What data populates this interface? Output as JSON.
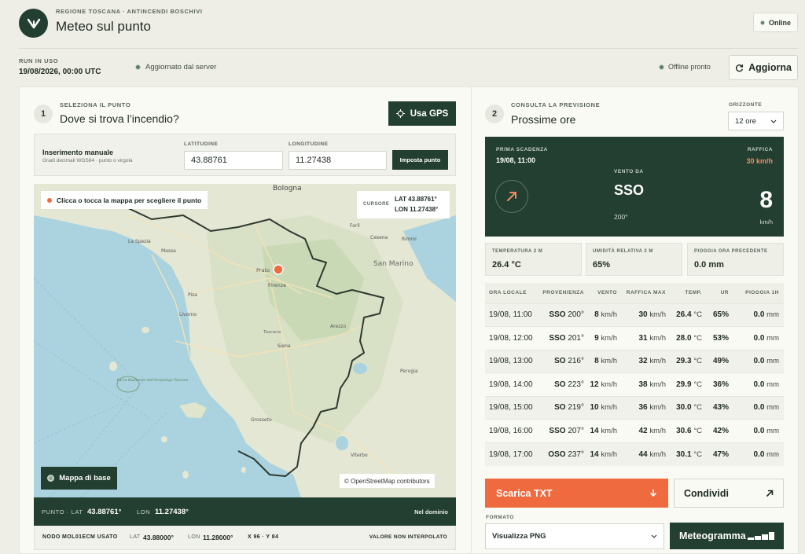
{
  "header": {
    "org": "REGIONE TOSCANA · ANTINCENDI BOSCHIVI",
    "title": "Meteo sul punto",
    "status": "Online"
  },
  "run": {
    "label": "RUN IN USO",
    "value": "19/08/2026, 00:00 UTC",
    "server_status": "Aggiornato dal server",
    "offline_status": "Offline pronto",
    "refresh_label": "Aggiorna"
  },
  "left": {
    "step": "1",
    "kicker": "SELEZIONA IL PUNTO",
    "title": "Dove si trova l’incendio?",
    "gps_label": "Usa GPS",
    "manual": {
      "title": "Inserimento manuale",
      "hint": "Gradi decimali WGS84 · punto o virgola",
      "lat_label": "LATITUDINE",
      "lat_value": "43.88761",
      "lon_label": "LONGITUDINE",
      "lon_value": "11.27438",
      "set_label": "Imposta punto"
    },
    "map": {
      "hint": "Clicca o tocca la mappa per scegliere il punto",
      "cursor_label": "CURSORE",
      "cursor_lat": "LAT 43.88761°",
      "cursor_lon": "LON 11.27438°",
      "basemap_label": "Mappa di base",
      "attribution": "© OpenStreetMap contributors",
      "places": {
        "bologna": "Bologna",
        "la_spezia": "La Spezia",
        "massa": "Massa",
        "pisa": "Pisa",
        "livorno": "Livorno",
        "prato": "Prato",
        "firenze": "Firenze",
        "arezzo": "Arezzo",
        "siena": "Siena",
        "grosseto": "Grosseto",
        "san_marino": "San Marino",
        "toscana": "Toscana",
        "forli": "Forlì",
        "cesena": "Cesena",
        "rimini": "Rimini",
        "viterbo": "Viterbo",
        "perugia": "Perugia",
        "park": "Parco Nazionale dell'Arcipelago Toscano"
      }
    },
    "point_bar": {
      "label": "PUNTO · LAT",
      "lat": "43.88761°",
      "lon_label": "LON",
      "lon": "11.27438°",
      "domain": "Nel dominio"
    },
    "node_bar": {
      "label": "NODO MOL01ECM USATO",
      "lat_label": "LAT",
      "lat": "43.88000°",
      "lon_label": "LON",
      "lon": "11.28000°",
      "grid": "X 96 · Y 84",
      "note": "VALORE NON INTERPOLATO"
    }
  },
  "right": {
    "step": "2",
    "kicker": "CONSULTA LA PREVISIONE",
    "title": "Prossime ore",
    "horizon_label": "ORIZZONTE",
    "horizon_value": "12 ore",
    "wind": {
      "first_label": "PRIMA SCADENZA",
      "first_value": "19/08, 11:00",
      "gust_label": "RAFFICA",
      "gust_value": "30 km/h",
      "from_label": "VENTO DA",
      "direction": "SSO",
      "degrees": "200°",
      "speed": "8",
      "unit": "km/h"
    },
    "stats": [
      {
        "label": "TEMPERATURA 2 M",
        "value": "26.4 °C"
      },
      {
        "label": "UMIDITÀ RELATIVA 2 M",
        "value": "65%"
      },
      {
        "label": "PIOGGIA ORA PRECEDENTE",
        "value": "0.0 mm"
      }
    ],
    "table": {
      "headers": [
        "ORA LOCALE",
        "PROVENIENZA",
        "VENTO",
        "RAFFICA MAX",
        "TEMP.",
        "UR",
        "PIOGGIA 1H"
      ],
      "rows": [
        {
          "time": "19/08, 11:00",
          "dir": "SSO",
          "deg": "200°",
          "wind": "8",
          "gust": "30",
          "temp": "26.4",
          "rh": "65%",
          "rain": "0.0"
        },
        {
          "time": "19/08, 12:00",
          "dir": "SSO",
          "deg": "201°",
          "wind": "9",
          "gust": "31",
          "temp": "28.0",
          "rh": "53%",
          "rain": "0.0"
        },
        {
          "time": "19/08, 13:00",
          "dir": "SO",
          "deg": "216°",
          "wind": "8",
          "gust": "32",
          "temp": "29.3",
          "rh": "49%",
          "rain": "0.0"
        },
        {
          "time": "19/08, 14:00",
          "dir": "SO",
          "deg": "223°",
          "wind": "12",
          "gust": "38",
          "temp": "29.9",
          "rh": "36%",
          "rain": "0.0"
        },
        {
          "time": "19/08, 15:00",
          "dir": "SO",
          "deg": "219°",
          "wind": "10",
          "gust": "36",
          "temp": "30.0",
          "rh": "43%",
          "rain": "0.0"
        },
        {
          "time": "19/08, 16:00",
          "dir": "SSO",
          "deg": "207°",
          "wind": "14",
          "gust": "42",
          "temp": "30.6",
          "rh": "42%",
          "rain": "0.0"
        },
        {
          "time": "19/08, 17:00",
          "dir": "OSO",
          "deg": "237°",
          "wind": "14",
          "gust": "44",
          "temp": "30.1",
          "rh": "47%",
          "rain": "0.0"
        }
      ],
      "kmh": "km/h",
      "degc": "°C",
      "mm": "mm"
    },
    "download_label": "Scarica TXT",
    "share_label": "Condividi",
    "format_label": "FORMATO",
    "format_value": "Visualizza PNG",
    "meteogram_label": "Meteogramma"
  },
  "colors": {
    "brand": "#233f31",
    "accent": "#ef6b3f",
    "background": "#eeeee6"
  }
}
